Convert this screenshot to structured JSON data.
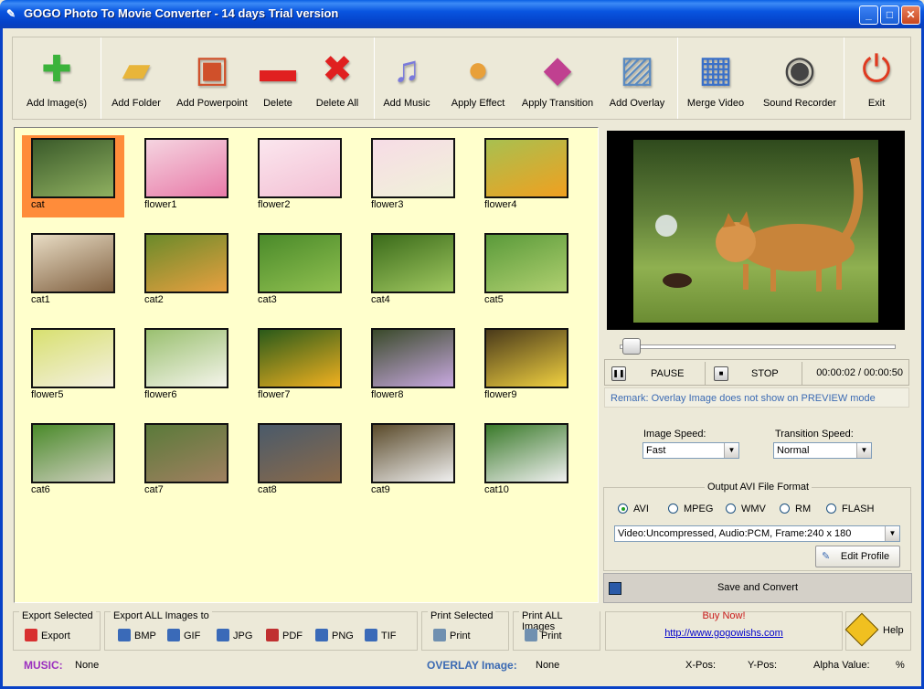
{
  "window": {
    "title": "GOGO Photo To Movie Converter - 14 days Trial version",
    "min": "_",
    "max": "□",
    "close": "✕"
  },
  "toolbar": [
    {
      "id": "add-images",
      "label": "Add Image(s)",
      "icon": "plus-icon",
      "color": "#3BB33B"
    },
    {
      "id": "add-folder",
      "label": "Add Folder",
      "icon": "folder-icon",
      "color": "#E8B53A"
    },
    {
      "id": "add-powerpoint",
      "label": "Add Powerpoint",
      "icon": "powerpoint-icon",
      "color": "#D0502A"
    },
    {
      "id": "delete",
      "label": "Delete",
      "icon": "minus-icon",
      "color": "#E02020"
    },
    {
      "id": "delete-all",
      "label": "Delete All",
      "icon": "x-icon",
      "color": "#E02020"
    },
    {
      "id": "add-music",
      "label": "Add Music",
      "icon": "music-note-icon",
      "color": "#7A7ADB"
    },
    {
      "id": "apply-effect",
      "label": "Apply Effect",
      "icon": "palette-icon",
      "color": "#E8A03A"
    },
    {
      "id": "apply-transition",
      "label": "Apply Transition",
      "icon": "transition-icon",
      "color": "#C04090"
    },
    {
      "id": "add-overlay",
      "label": "Add Overlay",
      "icon": "picture-icon",
      "color": "#5A8AC0"
    },
    {
      "id": "merge-video",
      "label": "Merge Video",
      "icon": "film-icon",
      "color": "#3A70C8"
    },
    {
      "id": "sound-recorder",
      "label": "Sound Recorder",
      "icon": "speaker-icon",
      "color": "#444444"
    },
    {
      "id": "exit",
      "label": "Exit",
      "icon": "power-icon",
      "color": "#E03A20"
    }
  ],
  "images": [
    {
      "name": "cat",
      "selected": true,
      "tone": [
        "#3a5a2a",
        "#8fb060"
      ]
    },
    {
      "name": "flower1",
      "tone": [
        "#f5d4e0",
        "#e87aa8"
      ]
    },
    {
      "name": "flower2",
      "tone": [
        "#fbe6ee",
        "#f3c0d4"
      ]
    },
    {
      "name": "flower3",
      "tone": [
        "#f7dce6",
        "#f0f2d8"
      ]
    },
    {
      "name": "flower4",
      "tone": [
        "#a8c050",
        "#f0a020"
      ]
    },
    {
      "name": "cat1",
      "tone": [
        "#e8dcc4",
        "#806040"
      ]
    },
    {
      "name": "cat2",
      "tone": [
        "#6a8a2a",
        "#e8a040"
      ]
    },
    {
      "name": "cat3",
      "tone": [
        "#4a8a2a",
        "#90c050"
      ]
    },
    {
      "name": "cat4",
      "tone": [
        "#3a6a1a",
        "#a0c860"
      ]
    },
    {
      "name": "cat5",
      "tone": [
        "#5a9a3a",
        "#b0d070"
      ]
    },
    {
      "name": "flower5",
      "tone": [
        "#d8e070",
        "#f4f0e0"
      ]
    },
    {
      "name": "flower6",
      "tone": [
        "#9ac070",
        "#f4f4ea"
      ]
    },
    {
      "name": "flower7",
      "tone": [
        "#2a5a1a",
        "#f0b020"
      ]
    },
    {
      "name": "flower8",
      "tone": [
        "#3a4a2a",
        "#c8a8e0"
      ]
    },
    {
      "name": "flower9",
      "tone": [
        "#4a3a1a",
        "#f0d040"
      ]
    },
    {
      "name": "cat6",
      "tone": [
        "#4a8a2a",
        "#d0d0c0"
      ]
    },
    {
      "name": "cat7",
      "tone": [
        "#5a7a3a",
        "#a08060"
      ]
    },
    {
      "name": "cat8",
      "tone": [
        "#4a5a6a",
        "#8a6a4a"
      ]
    },
    {
      "name": "cat9",
      "tone": [
        "#5a4a2a",
        "#f0f0f0"
      ]
    },
    {
      "name": "cat10",
      "tone": [
        "#3a7a2a",
        "#f0f0f0"
      ]
    }
  ],
  "player": {
    "pause": "PAUSE",
    "stop": "STOP",
    "time": "00:00:02 / 00:00:50",
    "progress": 0.02,
    "remark": "Remark: Overlay Image does not show on PREVIEW mode"
  },
  "speed": {
    "image_label": "Image Speed:",
    "image_value": "Fast",
    "transition_label": "Transition Speed:",
    "transition_value": "Normal"
  },
  "format": {
    "title": "Output AVI File Format",
    "options": [
      "AVI",
      "MPEG",
      "WMV",
      "RM",
      "FLASH"
    ],
    "selected": "AVI",
    "profile": "Video:Uncompressed, Audio:PCM, Frame:240 x 180",
    "edit": "Edit Profile"
  },
  "save": "Save and Convert",
  "bottom": {
    "export_selected": {
      "title": "Export Selected",
      "button": "Export"
    },
    "export_all": {
      "title": "Export ALL Images to",
      "formats": [
        "BMP",
        "GIF",
        "JPG",
        "PDF",
        "PNG",
        "TIF"
      ]
    },
    "print_selected": {
      "title": "Print Selected",
      "button": "Print"
    },
    "print_all": {
      "title": "Print ALL Images",
      "button": "Print"
    },
    "buy": {
      "title": "Buy Now!",
      "url": "http://www.gogowishs.com"
    },
    "help": "Help"
  },
  "status": {
    "music_label": "MUSIC:",
    "music_value": "None",
    "overlay_label": "OVERLAY Image:",
    "overlay_value": "None",
    "xpos": "X-Pos:",
    "ypos": "Y-Pos:",
    "alpha": "Alpha Value:",
    "percent": "%"
  }
}
